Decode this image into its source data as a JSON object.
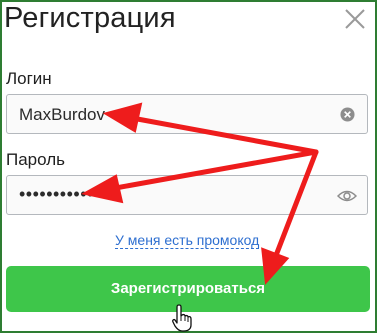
{
  "dialog": {
    "title": "Регистрация",
    "close_icon": "close-icon"
  },
  "login": {
    "label": "Логин",
    "value": "MaxBurdov",
    "clear_icon": "clear-circle-icon"
  },
  "password": {
    "label": "Пароль",
    "masked_value": "•••••••••••",
    "toggle_icon": "eye-icon"
  },
  "promo_link": "У меня есть промокод",
  "submit_label": "Зарегистрироваться",
  "annotations": {
    "arrow_color": "#ee1c1c",
    "arrow_icon": "red-arrow",
    "cursor_icon": "hand-pointer-icon"
  },
  "colors": {
    "border": "#2e7d32",
    "button": "#3ec64a",
    "link": "#2e6fd0"
  }
}
